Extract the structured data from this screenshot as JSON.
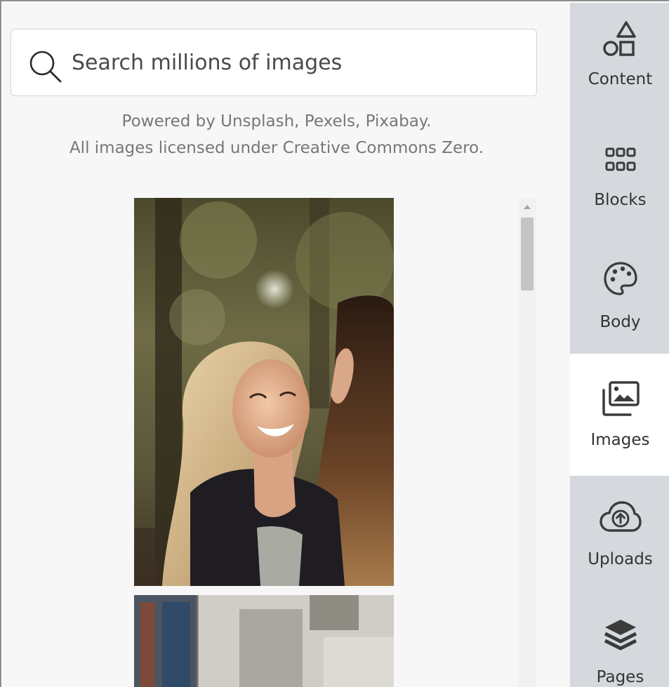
{
  "search": {
    "placeholder": "Search millions of images",
    "value": ""
  },
  "credits": {
    "line1": "Powered by Unsplash, Pexels, Pixabay.",
    "line2": "All images licensed under Creative Commons Zero."
  },
  "tabs": [
    {
      "id": "content",
      "label": "Content",
      "icon": "shapes-icon",
      "active": false
    },
    {
      "id": "blocks",
      "label": "Blocks",
      "icon": "grid-icon",
      "active": false
    },
    {
      "id": "body",
      "label": "Body",
      "icon": "palette-icon",
      "active": false
    },
    {
      "id": "images",
      "label": "Images",
      "icon": "images-icon",
      "active": true
    },
    {
      "id": "uploads",
      "label": "Uploads",
      "icon": "cloud-upload-icon",
      "active": false
    },
    {
      "id": "pages",
      "label": "Pages",
      "icon": "layers-icon",
      "active": false
    }
  ],
  "colors": {
    "tab_background": "#d5d9dd",
    "tab_active_background": "#ffffff",
    "panel_background": "#f7f7f7",
    "icon_color": "#3b3b3b"
  }
}
